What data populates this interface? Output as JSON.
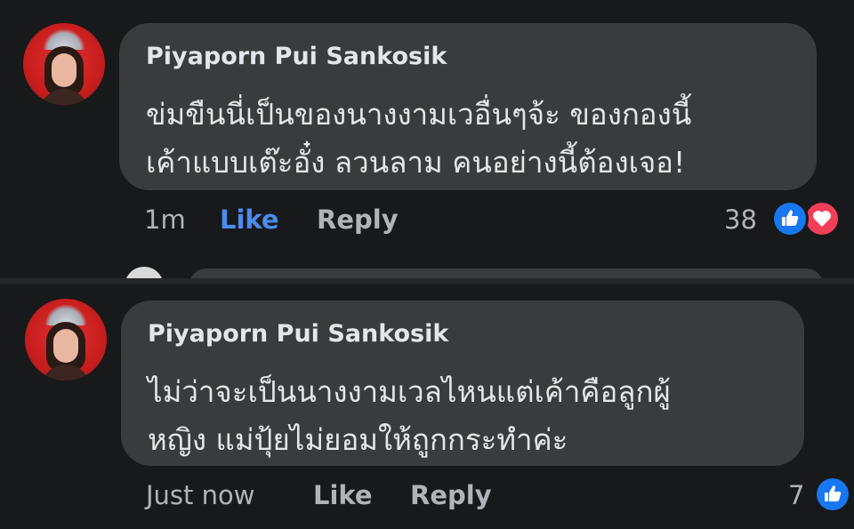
{
  "comments": [
    {
      "author": "Piyaporn Pui Sankosik",
      "lines": [
        "ข่มขืนนี่เป็นของนางงามเวอื่นๆจ้ะ ของกองนี้",
        "เค้าแบบเต๊ะอั๋ง ลวนลาม คนอย่างนี้ต้องเจอ!"
      ],
      "time": "1m",
      "like_label": "Like",
      "reply_label": "Reply",
      "reaction_count": "38",
      "reactions": [
        "like-icon",
        "love-icon"
      ],
      "like_active": true
    },
    {
      "author": "Piyaporn Pui Sankosik",
      "lines": [
        "ไม่ว่าจะเป็นนางงามเวลไหนแต่เค้าคือลูกผู้",
        "หญิง แม่ปุ้ยไม่ยอมให้ถูกกระทำค่ะ"
      ],
      "time": "Just now",
      "like_label": "Like",
      "reply_label": "Reply",
      "reaction_count": "7",
      "reactions": [
        "like-icon"
      ],
      "like_active": false
    }
  ],
  "colors": {
    "background": "#18191a",
    "bubble": "#3a3b3c",
    "text": "#e4e6eb",
    "muted": "#b0b3b8",
    "like_active": "#4a8cf0",
    "like_reaction": "#1877f2",
    "love_reaction": "#f33e58"
  }
}
